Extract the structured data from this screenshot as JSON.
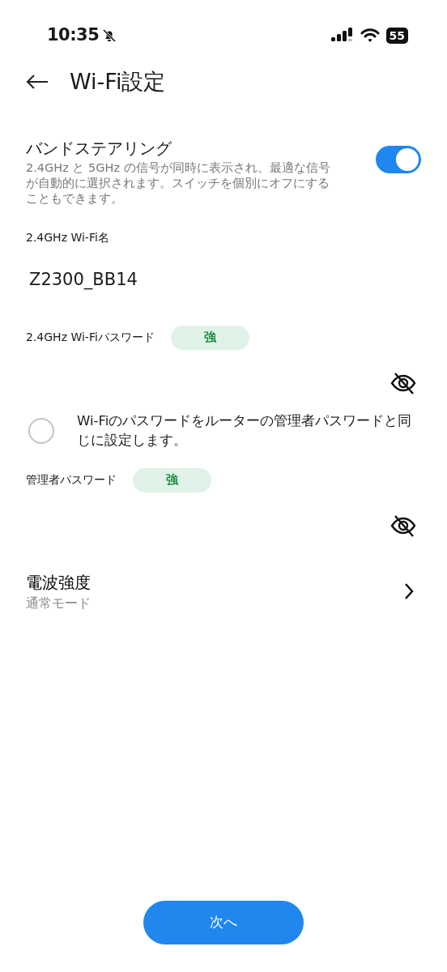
{
  "status_bar": {
    "time": "10:35",
    "silent": true,
    "battery": "55"
  },
  "header": {
    "title": "Wi-Fi設定"
  },
  "band_steering": {
    "title": "バンドステアリング",
    "description": "2.4GHz と 5GHz の信号が同時に表示され、最適な信号が自動的に選択されます。スイッチを個別にオフにすることもできます。",
    "on": true
  },
  "wifi_name": {
    "label": "2.4GHz Wi-Fi名",
    "value": "Z2300_BB14"
  },
  "wifi_password": {
    "label": "2.4GHz Wi-Fiパスワード",
    "strength": "強",
    "hidden": true
  },
  "same_as_admin": {
    "label": "Wi-Fiのパスワードをルーターの管理者パスワードと同じに設定します。",
    "checked": false
  },
  "admin_password": {
    "label": "管理者パスワード",
    "strength": "強",
    "hidden": true
  },
  "signal_strength": {
    "title": "電波強度",
    "value": "通常モード"
  },
  "next_button": "次へ"
}
